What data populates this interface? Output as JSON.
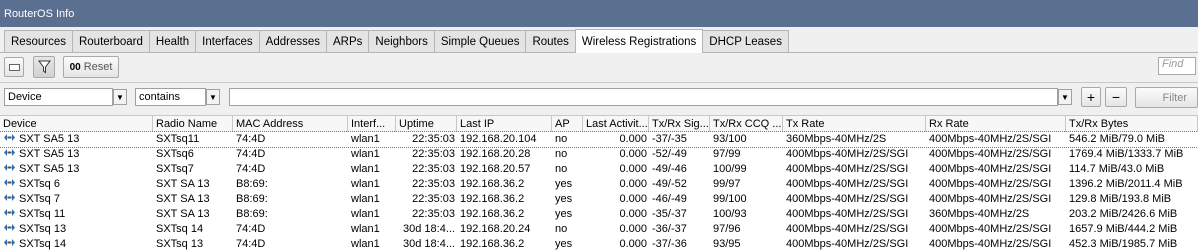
{
  "window": {
    "title": "RouterOS Info"
  },
  "tabs": [
    "Resources",
    "Routerboard",
    "Health",
    "Interfaces",
    "Addresses",
    "ARPs",
    "Neighbors",
    "Simple Queues",
    "Routes",
    "Wireless Registrations",
    "DHCP Leases"
  ],
  "active_tab": "Wireless Registrations",
  "toolbar": {
    "reset_label": "Reset",
    "reset_prefix": "00",
    "find_placeholder": "Find"
  },
  "filter": {
    "field": "Device",
    "operator": "contains",
    "value": "",
    "filter_button": "Filter",
    "add": "+",
    "remove": "−"
  },
  "table": {
    "columns": [
      "Device",
      "Radio Name",
      "MAC Address",
      "Interf...",
      "Uptime",
      "Last IP",
      "AP",
      "Last Activit...",
      "Tx/Rx Sig...",
      "Tx/Rx CCQ ...",
      "Tx Rate",
      "Rx Rate",
      "Tx/Rx Bytes"
    ],
    "rows": [
      [
        "SXT SA5 13",
        "SXTsq11",
        "74:4D",
        "wlan1",
        "22:35:03",
        "192.168.20.104",
        "no",
        "0.000",
        "-37/-35",
        "93/100",
        "360Mbps-40MHz/2S",
        "400Mbps-40MHz/2S/SGI",
        "546.2 MiB/79.0 MiB"
      ],
      [
        "SXT SA5 13",
        "SXTsq6",
        "74:4D",
        "wlan1",
        "22:35:03",
        "192.168.20.28",
        "no",
        "0.000",
        "-52/-49",
        "97/99",
        "400Mbps-40MHz/2S/SGI",
        "400Mbps-40MHz/2S/SGI",
        "1769.4 MiB/1333.7 MiB"
      ],
      [
        "SXT SA5 13",
        "SXTsq7",
        "74:4D",
        "wlan1",
        "22:35:03",
        "192.168.20.57",
        "no",
        "0.000",
        "-49/-46",
        "100/99",
        "400Mbps-40MHz/2S/SGI",
        "400Mbps-40MHz/2S/SGI",
        "114.7 MiB/43.0 MiB"
      ],
      [
        "SXTsq 6",
        "SXT SA 13",
        "B8:69:",
        "wlan1",
        "22:35:03",
        "192.168.36.2",
        "yes",
        "0.000",
        "-49/-52",
        "99/97",
        "400Mbps-40MHz/2S/SGI",
        "400Mbps-40MHz/2S/SGI",
        "1396.2 MiB/2011.4 MiB"
      ],
      [
        "SXTsq 7",
        "SXT SA 13",
        "B8:69:",
        "wlan1",
        "22:35:03",
        "192.168.36.2",
        "yes",
        "0.000",
        "-46/-49",
        "99/100",
        "400Mbps-40MHz/2S/SGI",
        "400Mbps-40MHz/2S/SGI",
        "129.8 MiB/193.8 MiB"
      ],
      [
        "SXTsq 11",
        "SXT SA 13",
        "B8:69:",
        "wlan1",
        "22:35:03",
        "192.168.36.2",
        "yes",
        "0.000",
        "-35/-37",
        "100/93",
        "400Mbps-40MHz/2S/SGI",
        "360Mbps-40MHz/2S",
        "203.2 MiB/2426.6 MiB"
      ],
      [
        "SXTsq 13",
        "SXTsq 14",
        "74:4D",
        "wlan1",
        "30d 18:4...",
        "192.168.20.24",
        "no",
        "0.000",
        "-36/-37",
        "97/96",
        "400Mbps-40MHz/2S/SGI",
        "400Mbps-40MHz/2S/SGI",
        "1657.9 MiB/444.2 MiB"
      ],
      [
        "SXTsq 14",
        "SXTsq 13",
        "74:4D",
        "wlan1",
        "30d 18:4...",
        "192.168.36.2",
        "yes",
        "0.000",
        "-37/-36",
        "93/95",
        "400Mbps-40MHz/2S/SGI",
        "400Mbps-40MHz/2S/SGI",
        "452.3 MiB/1985.7 MiB"
      ]
    ]
  }
}
